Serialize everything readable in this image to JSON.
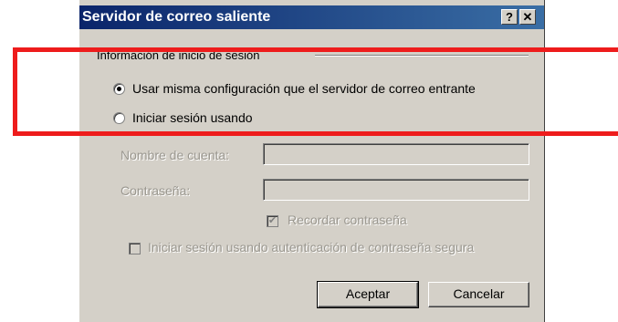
{
  "window": {
    "title": "Servidor de correo saliente",
    "help_label": "?",
    "close_label": "✕"
  },
  "group": {
    "legend": "Información de inicio de sesión"
  },
  "radio_same": {
    "label": "Usar misma configuración que el servidor de correo entrante",
    "checked": true
  },
  "radio_login": {
    "label": "Iniciar sesión usando",
    "checked": false
  },
  "account": {
    "label": "Nombre de cuenta:",
    "value": ""
  },
  "password": {
    "label": "Contraseña:",
    "value": ""
  },
  "remember": {
    "label": "Recordar contraseña",
    "checked": true
  },
  "spa": {
    "label": "Iniciar sesión usando autenticación de contraseña segura",
    "checked": false
  },
  "buttons": {
    "ok": "Aceptar",
    "cancel": "Cancelar"
  },
  "colors": {
    "highlight": "#ee1c1c",
    "titlebar": "#0a246a",
    "dialog_bg": "#d4d0c8"
  }
}
